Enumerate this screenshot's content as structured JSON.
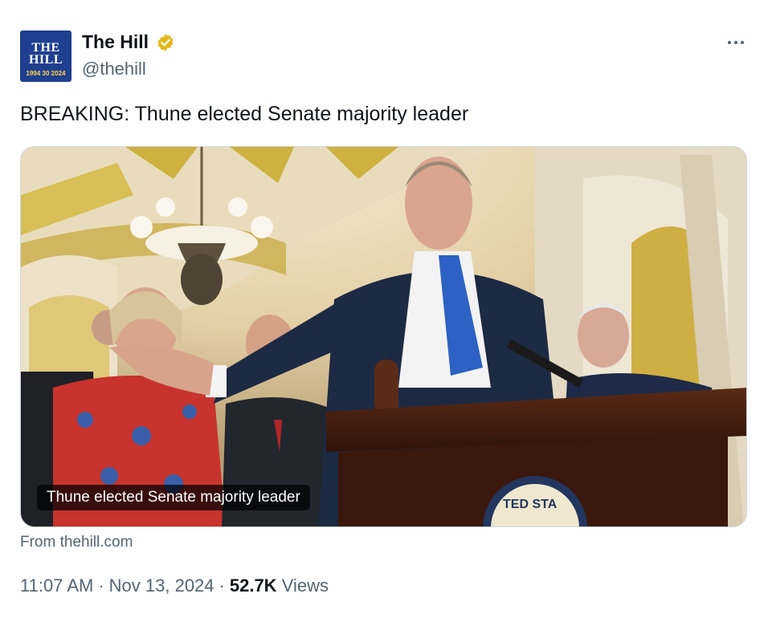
{
  "author": {
    "display_name": "The Hill",
    "handle": "@thehill",
    "avatar": {
      "line1": "THE",
      "line2": "HILL",
      "line3": "1994 30 2024",
      "bg": "#1f3f8f"
    },
    "verified_icon": "gold-verified-badge",
    "verified_color": "#e2b719"
  },
  "menu_icon": "more-horizontal-icon",
  "tweet": {
    "text": "BREAKING: Thune elected Senate majority leader"
  },
  "card": {
    "image_caption": "Thune elected Senate majority leader",
    "source": "From thehill.com",
    "seal_text": "TED STA"
  },
  "meta": {
    "time": "11:07 AM",
    "separator": "·",
    "date": "Nov 13, 2024",
    "views_count": "52.7K",
    "views_label": "Views"
  },
  "colors": {
    "text_primary": "#0f1419",
    "text_secondary": "#536471",
    "border": "#cfd9de"
  }
}
